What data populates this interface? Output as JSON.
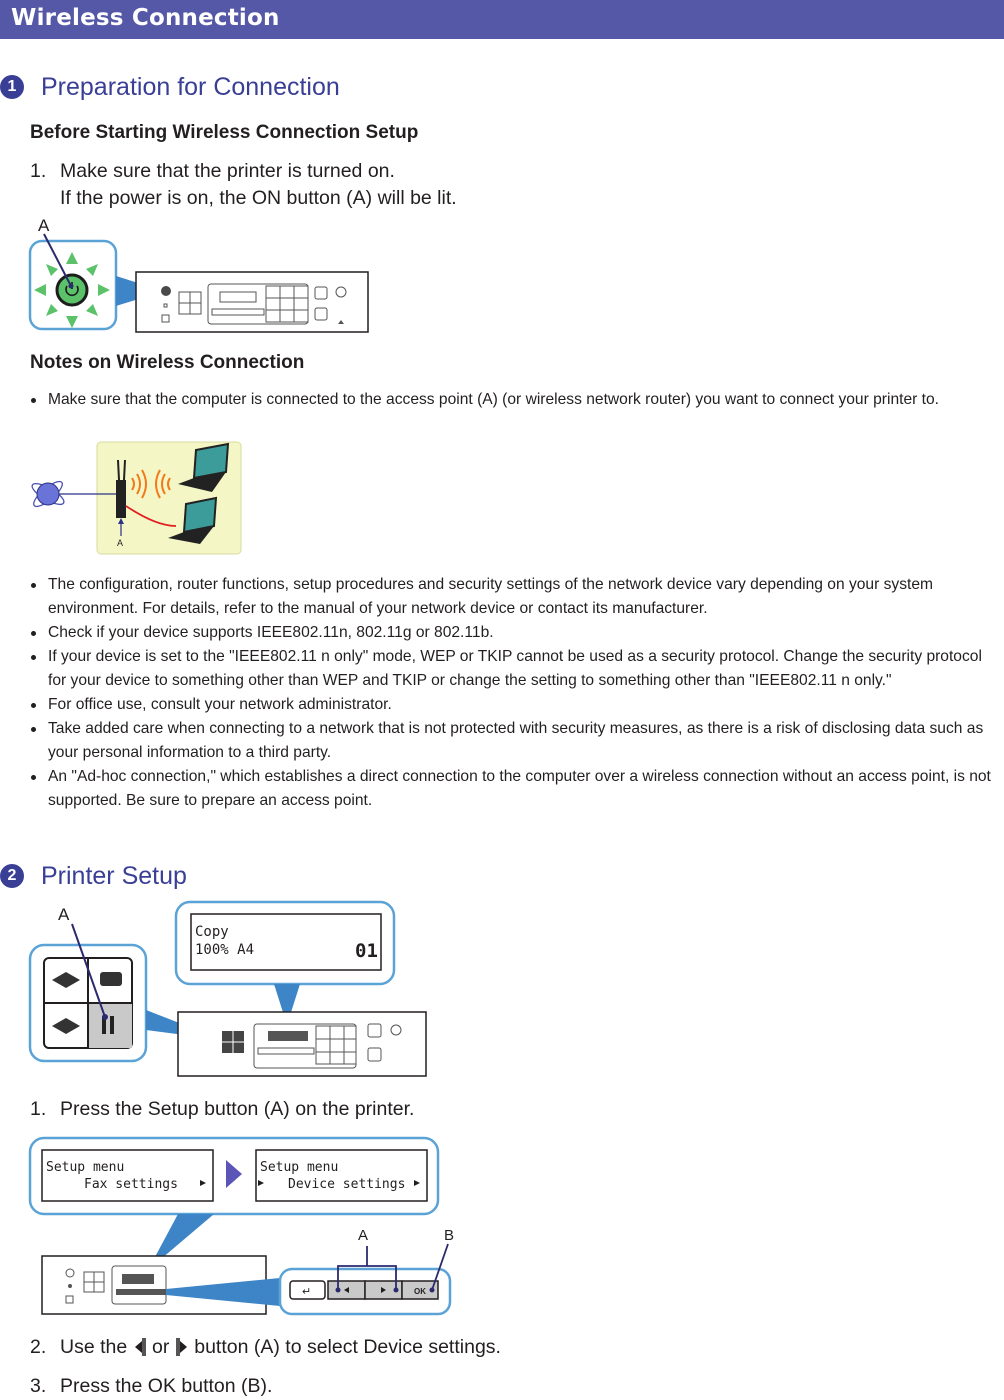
{
  "header": {
    "title": "Wireless Connection",
    "color": "#5458a6"
  },
  "section1": {
    "number": "1",
    "title": "Preparation for Connection",
    "subheading1": "Before Starting Wireless Connection Setup",
    "step1": {
      "num": "1.",
      "line1": "Make sure that the printer is turned on.",
      "line2": "If the power is on, the ON button (A) will be lit."
    },
    "figure1": {
      "label_a": "A"
    },
    "subheading2": "Notes on Wireless Connection",
    "note_first": "Make sure that the computer is connected to the access point (A) (or wireless network router) you want to connect your printer to.",
    "figure2": {
      "label_a": "A"
    },
    "notes": [
      "The configuration, router functions, setup procedures and security settings of the network device vary depending on your system environment. For details, refer to the manual of your network device or contact its manufacturer.",
      "Check if your device supports IEEE802.11n, 802.11g or 802.11b.",
      "If your device is set to the \"IEEE802.11 n only\" mode, WEP or TKIP cannot be used as a security protocol. Change the security protocol for your device to something other than WEP and TKIP or change the setting to something other than \"IEEE802.11 n only.\"",
      "For office use, consult your network administrator.",
      "Take added care when connecting to a network that is not protected with security measures, as there is a risk of disclosing data such as your personal information to a third party.",
      "An \"Ad-hoc connection,\" which establishes a direct connection to the computer over a wireless connection without an access point, is not supported. Be sure to prepare an access point."
    ]
  },
  "section2": {
    "number": "2",
    "title": "Printer Setup",
    "figure3": {
      "label_a": "A",
      "lcd_line1": "Copy",
      "lcd_line2": "100%  A4",
      "lcd_count": "01"
    },
    "step1": {
      "num": "1.",
      "text": "Press the Setup button (A) on the printer."
    },
    "figure4": {
      "lcd_left_line1": "Setup menu",
      "lcd_left_line2": "Fax settings",
      "lcd_right_line1": "Setup menu",
      "lcd_right_line2": "Device settings",
      "label_a": "A",
      "label_b": "B",
      "ok_label": "OK"
    },
    "step2": {
      "num": "2.",
      "pre": "Use the",
      "mid": "or",
      "post": "button (A) to select Device settings."
    },
    "step3": {
      "num": "3.",
      "text": "Press the OK button (B)."
    }
  }
}
